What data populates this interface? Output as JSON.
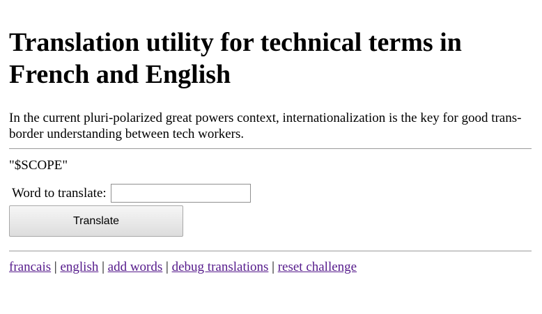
{
  "header": {
    "title": "Translation utility for technical terms in French and English"
  },
  "intro": {
    "text": "In the current pluri-polarized great powers context, internationalization is the key for good trans-border understanding between tech workers."
  },
  "scope": {
    "text": "\"$SCOPE\""
  },
  "form": {
    "word_label": "Word to translate:",
    "word_value": "",
    "translate_label": "Translate"
  },
  "footer": {
    "links": [
      {
        "label": "francais"
      },
      {
        "label": "english"
      },
      {
        "label": "add words"
      },
      {
        "label": "debug translations"
      },
      {
        "label": "reset challenge"
      }
    ],
    "separator": "|"
  },
  "colors": {
    "link": "#551a8b",
    "rule": "#9a9a9a"
  }
}
